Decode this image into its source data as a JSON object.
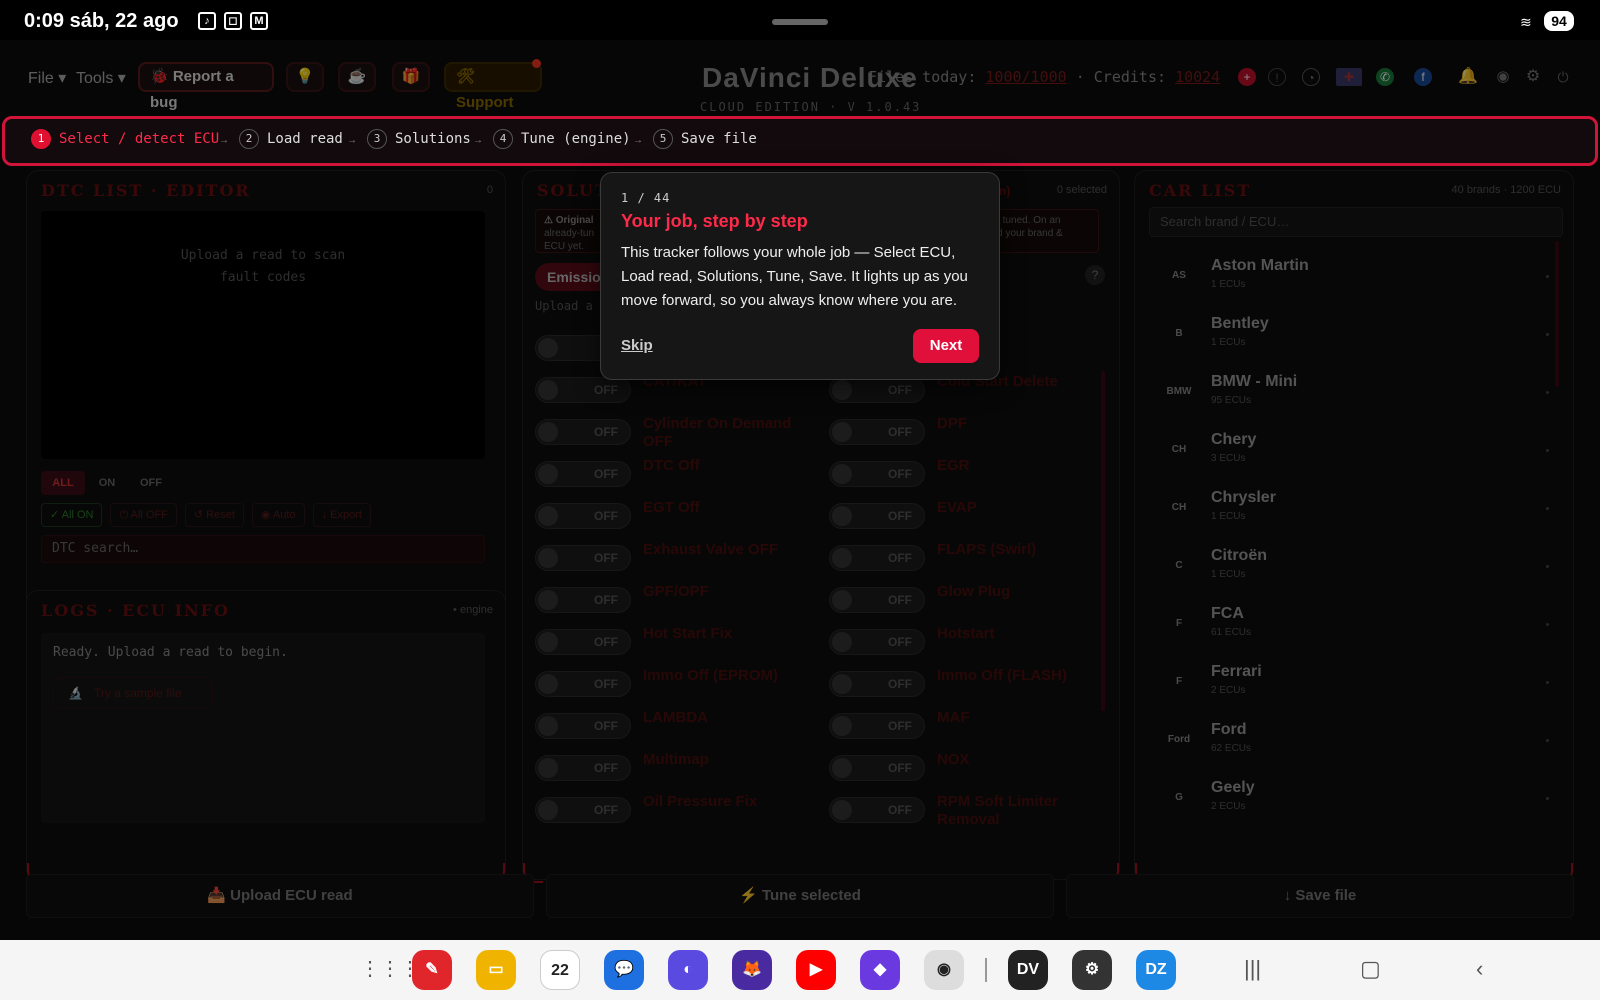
{
  "statusbar": {
    "time": "0:09",
    "date": "sáb, 22 ago",
    "battery": "94"
  },
  "menubar": {
    "file": "File ▾",
    "tools": "Tools ▾",
    "report_bug": "🐞 Report a bug",
    "support": "🛠Support"
  },
  "brand": {
    "name": "DaVinci Deluxe",
    "edition": "CLOUD EDITION · V 1.0.43"
  },
  "stats": {
    "files_label": "Files today:",
    "files_value": "1000/1000",
    "credits_label": "Credits:",
    "credits_value": "10024"
  },
  "stepper": {
    "steps": [
      {
        "n": "1",
        "label": "Select / detect ECU"
      },
      {
        "n": "2",
        "label": "Load read"
      },
      {
        "n": "3",
        "label": "Solutions"
      },
      {
        "n": "4",
        "label": "Tune (engine)"
      },
      {
        "n": "5",
        "label": "Save file"
      }
    ],
    "arrow": "→"
  },
  "dtc": {
    "title": "DTC LIST · EDITOR",
    "count": "0",
    "empty_line1": "Upload a read to scan",
    "empty_line2": "fault codes",
    "filters": [
      "ALL",
      "ON",
      "OFF"
    ],
    "actions": [
      "✓ All ON",
      "⏻ All OFF",
      "↺ Reset",
      "◉ Auto",
      "↓ Export"
    ],
    "search_placeholder": "DTC search…"
  },
  "logs": {
    "title": "LOGS · ECU INFO",
    "meta": "• engine",
    "ready": "Ready. Upload a read to begin.",
    "sample": "Try a sample file"
  },
  "solutions": {
    "title": "SOLUT",
    "filter_tail": "n)",
    "selected": "0 selected",
    "warn_left_1": "⚠ Original",
    "warn_left_2": "already-tun",
    "warn_left_3": "ECU yet.",
    "warn_right_1": "ver tuned. On an",
    "warn_right_2": "ded your brand &",
    "emission_tab": "Emissio",
    "upload_hint": "Upload a r",
    "off_label": "OFF",
    "left": [
      "",
      "CAT/KAT",
      "Cylinder On Demand OFF",
      "DTC Off",
      "EGT Off",
      "Exhaust Valve OFF",
      "GPF/OPF",
      "Hot Start Fix",
      "Immo Off (EPROM)",
      "LAMBDA",
      "Multimap",
      "Oil Pressure Fix"
    ],
    "right": [
      "",
      "Cold Start Delete",
      "DPF",
      "EGR",
      "EVAP",
      "FLAPS (Swirl)",
      "Glow Plug",
      "Hotstart",
      "Immo Off (FLASH)",
      "MAF",
      "NOX",
      "RPM Soft Limiter Removal"
    ]
  },
  "carlist": {
    "title": "CAR LIST",
    "meta": "40 brands · 1200 ECU",
    "search_placeholder": "Search brand / ECU…",
    "brands": [
      {
        "name": "Aston Martin",
        "count": "1 ECUs",
        "logo": "AS"
      },
      {
        "name": "Bentley",
        "count": "1 ECUs",
        "logo": "B"
      },
      {
        "name": "BMW - Mini",
        "count": "95 ECUs",
        "logo": "BMW"
      },
      {
        "name": "Chery",
        "count": "3 ECUs",
        "logo": "CH"
      },
      {
        "name": "Chrysler",
        "count": "1 ECUs",
        "logo": "CH"
      },
      {
        "name": "Citroën",
        "count": "1 ECUs",
        "logo": "C"
      },
      {
        "name": "FCA",
        "count": "61 ECUs",
        "logo": "F"
      },
      {
        "name": "Ferrari",
        "count": "2 ECUs",
        "logo": "F"
      },
      {
        "name": "Ford",
        "count": "62 ECUs",
        "logo": "Ford"
      },
      {
        "name": "Geely",
        "count": "2 ECUs",
        "logo": "G"
      }
    ]
  },
  "bottom": {
    "upload": "📥 Upload ECU read",
    "tune": "⚡ Tune selected",
    "save": "↓ Save file"
  },
  "tour": {
    "step": "1 / 44",
    "title": "Your job, step by step",
    "body": "This tracker follows your whole job — Select ECU, Load read, Solutions, Tune, Save. It lights up as you move forward, so you always know where you are.",
    "skip": "Skip",
    "next": "Next"
  },
  "dock": {
    "calendar_day": "22",
    "dz": "DZ"
  },
  "colors": {
    "accent": "#e0103a",
    "panel_title": "#6a1010",
    "background": "#0b0b0b"
  }
}
